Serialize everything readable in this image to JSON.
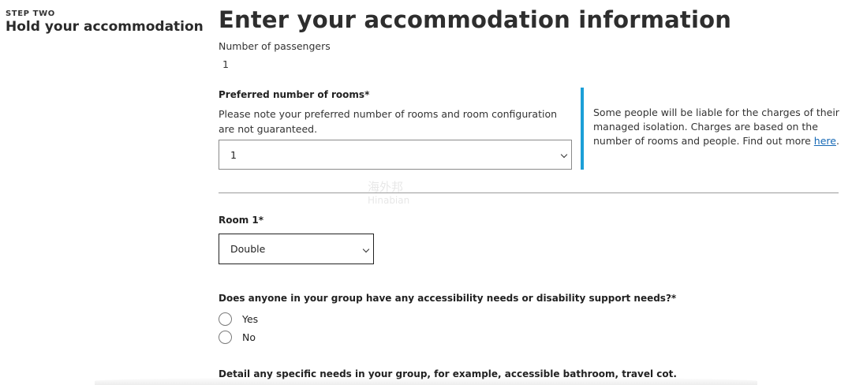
{
  "step": {
    "label": "STEP TWO",
    "title": "Hold your accommodation"
  },
  "page": {
    "title": "Enter your accommodation information"
  },
  "passengers": {
    "label": "Number of passengers",
    "value": "1"
  },
  "rooms": {
    "label": "Preferred number of rooms*",
    "hint": "Please note your preferred number of rooms and room configuration are not guaranteed.",
    "selected": "1"
  },
  "callout": {
    "text": "Some people will be liable for the charges of their managed isolation. Charges are based on the number of rooms and people. Find out more ",
    "link": "here",
    "suffix": ".",
    "color": "#1c9fd7"
  },
  "room1": {
    "label": "Room 1*",
    "selected": "Double"
  },
  "accessibility": {
    "question": "Does anyone in your group have any accessibility needs or disability support needs?*",
    "options": [
      "Yes",
      "No"
    ]
  },
  "details": {
    "label": "Detail any specific needs in your group, for example, accessible bathroom, travel cot."
  },
  "watermark": {
    "line1": "海外邦",
    "line2": "Hinabian"
  }
}
